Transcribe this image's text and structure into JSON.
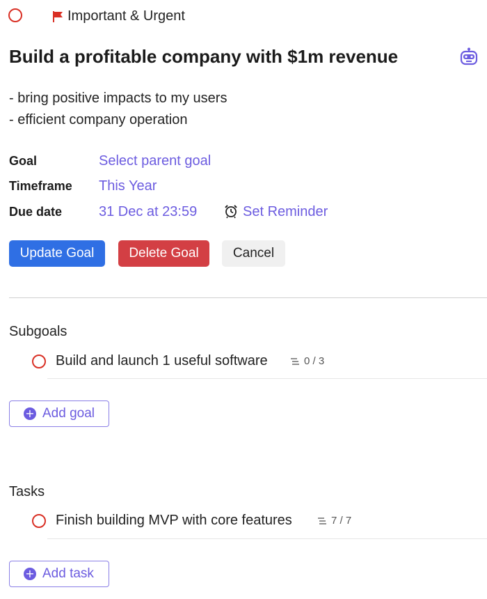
{
  "header": {
    "priority_label": "Important & Urgent",
    "priority_color": "#d93025"
  },
  "goal": {
    "title": "Build a profitable company with $1m revenue",
    "description": [
      "- bring positive impacts to my users",
      "- efficient company operation"
    ]
  },
  "meta": {
    "goal_label": "Goal",
    "goal_value": "Select parent goal",
    "timeframe_label": "Timeframe",
    "timeframe_value": "This Year",
    "due_label": "Due date",
    "due_value": "31 Dec at 23:59",
    "reminder_label": "Set Reminder"
  },
  "actions": {
    "update": "Update Goal",
    "delete": "Delete Goal",
    "cancel": "Cancel"
  },
  "subgoals": {
    "title": "Subgoals",
    "items": [
      {
        "label": "Build and launch 1 useful software",
        "count": "0 / 3"
      }
    ],
    "add_label": "Add goal"
  },
  "tasks": {
    "title": "Tasks",
    "items": [
      {
        "label": "Finish building MVP with core features",
        "count": "7 / 7"
      }
    ],
    "add_label": "Add task"
  },
  "icons": [
    "status-circle-icon",
    "flag-icon",
    "robot-icon",
    "alarm-clock-icon",
    "subtasks-icon",
    "plus-icon"
  ],
  "colors": {
    "accent": "#6c5ce0",
    "primary_button": "#2f6fe4",
    "danger_button": "#d33f44",
    "status_red": "#d93025"
  }
}
